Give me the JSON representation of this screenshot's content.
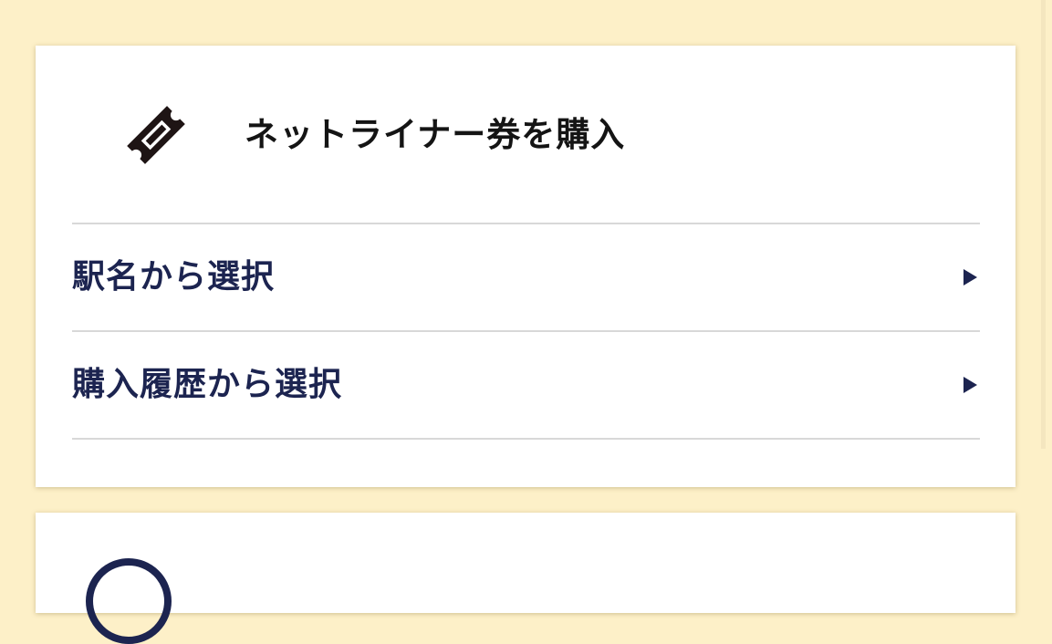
{
  "purchase_card": {
    "title": "ネットライナー券を購入",
    "icon": "ticket-icon",
    "menu_items": [
      {
        "label": "駅名から選択",
        "icon": "chevron-right-icon"
      },
      {
        "label": "購入履歴から選択",
        "icon": "chevron-right-icon"
      }
    ]
  },
  "next_card": {
    "icon": "circle-icon"
  },
  "colors": {
    "background": "#fdf0c8",
    "card": "#ffffff",
    "text_dark": "#141414",
    "text_navy": "#1c2450",
    "divider": "#d8d8d8"
  }
}
